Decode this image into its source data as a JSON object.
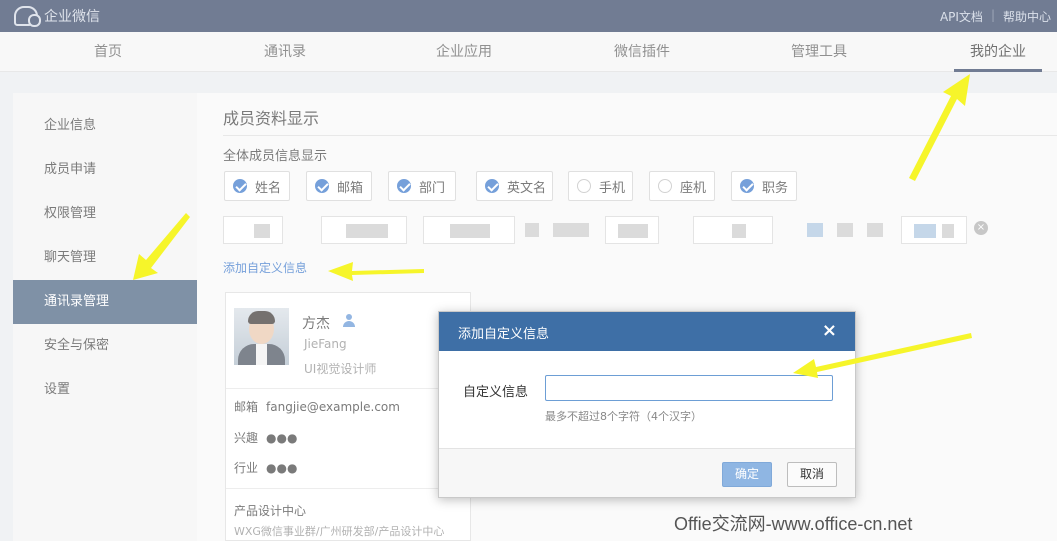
{
  "header": {
    "brand": "企业微信",
    "links": [
      "API文档",
      "帮助中心"
    ]
  },
  "nav": {
    "items": [
      "首页",
      "通讯录",
      "企业应用",
      "微信插件",
      "管理工具",
      "我的企业"
    ],
    "active": "我的企业"
  },
  "sidebar": {
    "items": [
      "企业信息",
      "成员申请",
      "权限管理",
      "聊天管理",
      "通讯录管理",
      "安全与保密",
      "设置"
    ],
    "active": "通讯录管理"
  },
  "main": {
    "title": "成员资料显示",
    "section_label": "全体成员信息显示",
    "fields": [
      {
        "label": "姓名",
        "checked": true
      },
      {
        "label": "邮箱",
        "checked": true
      },
      {
        "label": "部门",
        "checked": true
      },
      {
        "label": "英文名",
        "checked": true
      },
      {
        "label": "手机",
        "checked": false
      },
      {
        "label": "座机",
        "checked": false
      },
      {
        "label": "职务",
        "checked": true
      }
    ],
    "add_link": "添加自定义信息"
  },
  "card": {
    "name": "方杰",
    "english_name": "JieFang",
    "role": "UI视觉设计师",
    "email_label": "邮箱",
    "email": "fangjie@example.com",
    "hobby_label": "兴趣",
    "hobby": "●●●",
    "industry_label": "行业",
    "industry": "●●●",
    "dept": "产品设计中心",
    "dept_path": "WXG微信事业群/广州研发部/产品设计中心"
  },
  "dialog": {
    "title": "添加自定义信息",
    "close": "×",
    "field_label": "自定义信息",
    "field_value": "",
    "hint": "最多不超过8个字符（4个汉字）",
    "ok": "确定",
    "cancel": "取消"
  },
  "watermark": "Offie交流网-www.office-cn.net",
  "colors": {
    "topbar": "#25375a",
    "sidebar_active": "#3b5677",
    "dialog_header": "#3e6fa6",
    "link": "#2d6ec7",
    "arrow": "#f6f52a"
  }
}
